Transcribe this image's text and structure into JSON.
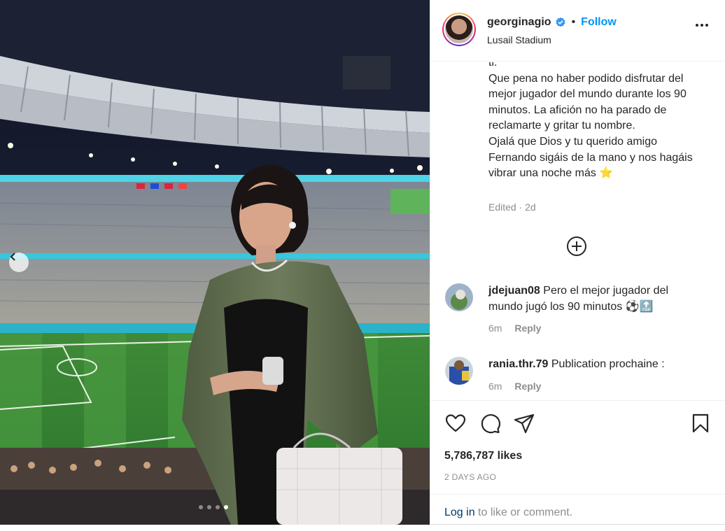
{
  "header": {
    "username": "georginagio",
    "separator": "•",
    "follow_label": "Follow",
    "location": "Lusail Stadium"
  },
  "media": {
    "slide_count": 4,
    "active_slide": 4
  },
  "caption": {
    "truncated_top": "ti.",
    "text": "Que pena no haber podido disfrutar del mejor jugador del mundo durante los 90 minutos. La afición no ha parado de reclamarte y gritar tu nombre.\nOjalá que Dios y tu querido amigo Fernando sigáis de la mano y nos hagáis vibrar una noche más ⭐",
    "meta": "Edited · 2d"
  },
  "comments": [
    {
      "username": "jdejuan08",
      "text": "Pero el mejor jugador del mundo jugó los 90 minutos ⚽🔝",
      "time": "6m",
      "reply_label": "Reply"
    },
    {
      "username": "rania.thr.79",
      "text": "Publication prochaine :",
      "time": "6m",
      "reply_label": "Reply"
    }
  ],
  "icons": {
    "like": "heart-icon",
    "comment": "comment-icon",
    "share": "share-icon",
    "save": "bookmark-icon",
    "more": "more-options-icon",
    "load_more": "plus-circle-icon",
    "prev": "chevron-left-icon",
    "verified": "verified-badge-icon"
  },
  "engagement": {
    "likes": "5,786,787 likes",
    "time_ago": "2 DAYS AGO"
  },
  "login": {
    "link": "Log in",
    "rest": " to like or comment."
  },
  "colors": {
    "accent": "#0095f6",
    "verified": "#3897f0",
    "muted": "#8e8e8e",
    "text": "#262626"
  }
}
